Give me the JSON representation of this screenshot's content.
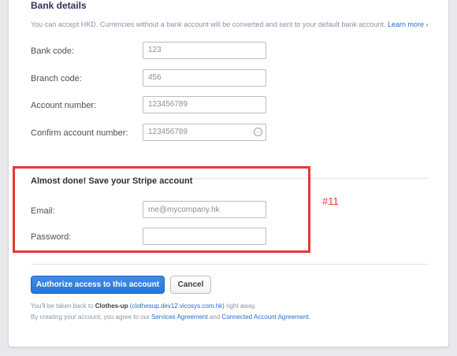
{
  "bank_details": {
    "title": "Bank details",
    "intro_text": "You can accept HKD. Currencies without a bank account will be converted and sent to your default bank account.",
    "learn_more": "Learn more ›",
    "fields": {
      "bank_code": {
        "label": "Bank code:",
        "value": "123"
      },
      "branch_code": {
        "label": "Branch code:",
        "value": "456"
      },
      "account_number": {
        "label": "Account number:",
        "value": "123456789"
      },
      "confirm_account_number": {
        "label": "Confirm account number:",
        "value": "123456789"
      }
    }
  },
  "save_account": {
    "title": "Almost done! Save your Stripe account",
    "email": {
      "label": "Email:",
      "placeholder": "me@mycompany.hk"
    },
    "password": {
      "label": "Password:",
      "value": ""
    }
  },
  "annotation": {
    "marker": "#11",
    "color": "#e53935"
  },
  "actions": {
    "authorize_label": "Authorize access to this account",
    "cancel_label": "Cancel"
  },
  "footer": {
    "line1_prefix": "You'll be taken back to",
    "app_name": "Clothes-up",
    "app_url": "(clothesup.dev12.vicosys.com.hk)",
    "line1_suffix": "right away.",
    "line2_prefix": "By creating your account, you agree to our",
    "services_agreement": "Services Agreement",
    "and": "and",
    "connected_agreement": "Connected Account Agreement",
    "period": "."
  },
  "colors": {
    "primary": "#2776d4",
    "link": "#1f6fd0",
    "highlight": "#e53935"
  }
}
